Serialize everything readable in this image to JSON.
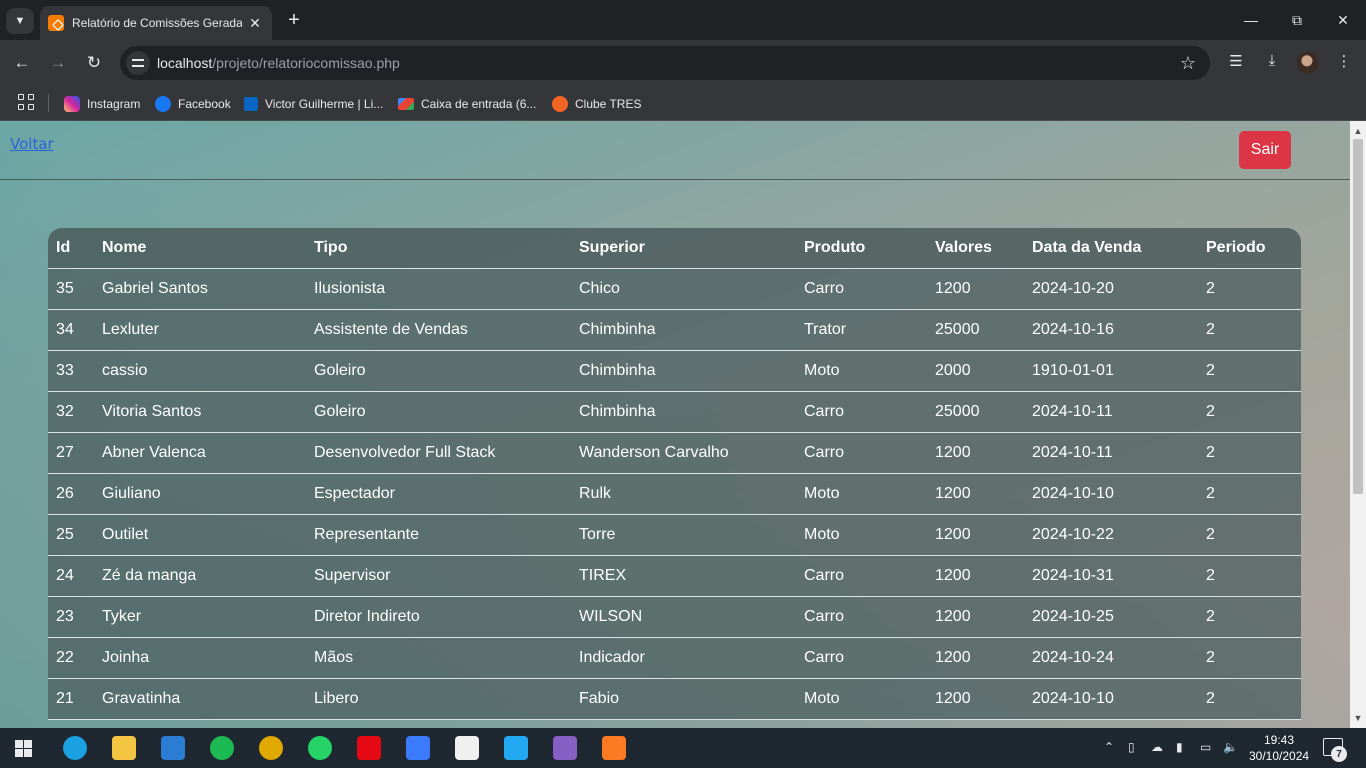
{
  "browser": {
    "tab_title": "Relatório de Comissões Geradas",
    "url_host": "localhost",
    "url_path": "/projeto/relatoriocomissao.php",
    "bookmarks": [
      {
        "label": "Instagram",
        "icon": "instagram-icon",
        "color": "#d6249f"
      },
      {
        "label": "Facebook",
        "icon": "facebook-icon",
        "color": "#1877f2"
      },
      {
        "label": "Victor Guilherme | Li...",
        "icon": "linkedin-icon",
        "color": "#0a66c2"
      },
      {
        "label": "Caixa de entrada (6...",
        "icon": "gmail-icon",
        "color": "#ea4335"
      },
      {
        "label": "Clube TRES",
        "icon": "clube-tres-icon",
        "color": "#f26522"
      }
    ]
  },
  "page": {
    "back_link": "Voltar",
    "logout_button": "Sair",
    "logout_color": "#dc3545"
  },
  "table": {
    "headers": [
      "Id",
      "Nome",
      "Tipo",
      "Superior",
      "Produto",
      "Valores",
      "Data da Venda",
      "Periodo"
    ],
    "rows": [
      [
        "35",
        "Gabriel Santos",
        "Ilusionista",
        "Chico",
        "Carro",
        "1200",
        "2024-10-20",
        "2"
      ],
      [
        "34",
        "Lexluter",
        "Assistente de Vendas",
        "Chimbinha",
        "Trator",
        "25000",
        "2024-10-16",
        "2"
      ],
      [
        "33",
        "cassio",
        "Goleiro",
        "Chimbinha",
        "Moto",
        "2000",
        "1910-01-01",
        "2"
      ],
      [
        "32",
        "Vitoria Santos",
        "Goleiro",
        "Chimbinha",
        "Carro",
        "25000",
        "2024-10-11",
        "2"
      ],
      [
        "27",
        "Abner Valenca",
        "Desenvolvedor Full Stack",
        "Wanderson Carvalho",
        "Carro",
        "1200",
        "2024-10-11",
        "2"
      ],
      [
        "26",
        "Giuliano",
        "Espectador",
        "Rulk",
        "Moto",
        "1200",
        "2024-10-10",
        "2"
      ],
      [
        "25",
        "Outilet",
        "Representante",
        "Torre",
        "Moto",
        "1200",
        "2024-10-22",
        "2"
      ],
      [
        "24",
        "Zé da manga",
        "Supervisor",
        "TIREX",
        "Carro",
        "1200",
        "2024-10-31",
        "2"
      ],
      [
        "23",
        "Tyker",
        "Diretor Indireto",
        "WILSON",
        "Carro",
        "1200",
        "2024-10-25",
        "2"
      ],
      [
        "22",
        "Joinha",
        "Mãos",
        "Indicador",
        "Carro",
        "1200",
        "2024-10-24",
        "2"
      ],
      [
        "21",
        "Gravatinha",
        "Libero",
        "Fabio",
        "Moto",
        "1200",
        "2024-10-10",
        "2"
      ]
    ]
  },
  "taskbar": {
    "time": "19:43",
    "date": "30/10/2024",
    "notifications": "7",
    "apps": [
      {
        "name": "edge-icon",
        "color": "#1ba0e2"
      },
      {
        "name": "file-explorer-icon",
        "color": "#f4c542"
      },
      {
        "name": "mail-icon",
        "color": "#2b7cd3"
      },
      {
        "name": "spotify-icon",
        "color": "#1db954"
      },
      {
        "name": "chrome-icon",
        "color": "#e0a800"
      },
      {
        "name": "whatsapp-icon",
        "color": "#25d366"
      },
      {
        "name": "netflix-icon",
        "color": "#e50914"
      },
      {
        "name": "intellij-icon",
        "color": "#3d7bfd"
      },
      {
        "name": "github-icon",
        "color": "#f0f0f0"
      },
      {
        "name": "vscode-icon",
        "color": "#23a9f2"
      },
      {
        "name": "visual-studio-icon",
        "color": "#865fc5"
      },
      {
        "name": "xampp-icon",
        "color": "#fb7a24"
      }
    ]
  }
}
